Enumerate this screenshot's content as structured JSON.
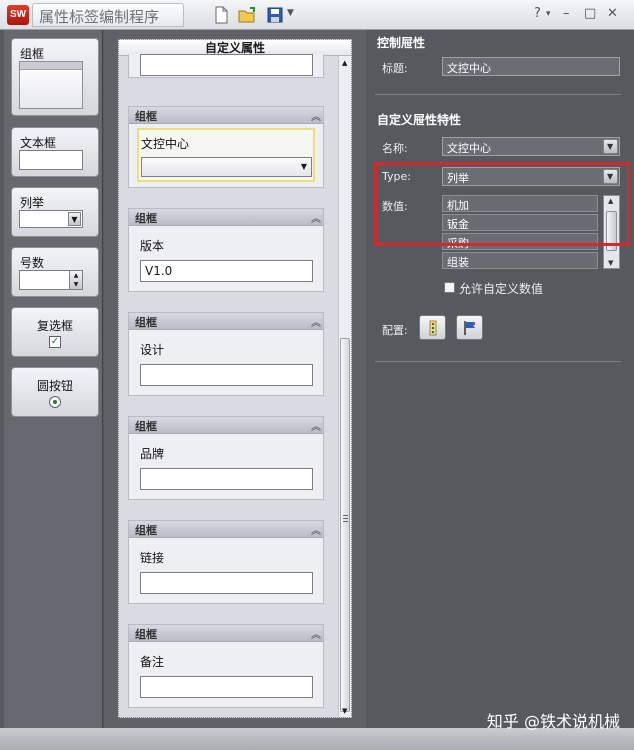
{
  "app": {
    "logo": "SW",
    "title": "属性标签编制程序"
  },
  "toolbar": {
    "icons": [
      "new-file-icon",
      "open-folder-icon",
      "save-icon"
    ]
  },
  "window_controls": [
    "?",
    "▾",
    "–",
    "□",
    "✕"
  ],
  "toolbox": {
    "items": [
      {
        "label": "组框"
      },
      {
        "label": "文本框"
      },
      {
        "label": "列举"
      },
      {
        "label": "号数"
      },
      {
        "label": "复选框"
      },
      {
        "label": "圆按钮"
      }
    ]
  },
  "canvas": {
    "header": "自定义属性",
    "groups": [
      {
        "title": "组框",
        "label": "文控中心",
        "value": "",
        "type": "dropdown"
      },
      {
        "title": "组框",
        "label": "版本",
        "value": "V1.0"
      },
      {
        "title": "组框",
        "label": "设计",
        "value": ""
      },
      {
        "title": "组框",
        "label": "品牌",
        "value": ""
      },
      {
        "title": "组框",
        "label": "链接",
        "value": ""
      },
      {
        "title": "组框",
        "label": "备注",
        "value": ""
      }
    ]
  },
  "props": {
    "control_section": "控制屉性",
    "caption_label": "标题:",
    "caption_value": "文控中心",
    "custom_section": "自定义屉性特性",
    "name_label": "名称:",
    "name_value": "文控中心",
    "type_label": "Type:",
    "type_value": "列举",
    "values_label": "数值:",
    "values": [
      "机加",
      "钣金",
      "采购",
      "组装"
    ],
    "allow_custom": "允许自定义数值",
    "allow_custom_checked": false,
    "config_label": "配置:"
  },
  "colors": {
    "highlight": "#d6282c",
    "panel_bg": "#56595e",
    "logo": "#c4200f"
  },
  "watermark": "知乎 @铁术说机械"
}
